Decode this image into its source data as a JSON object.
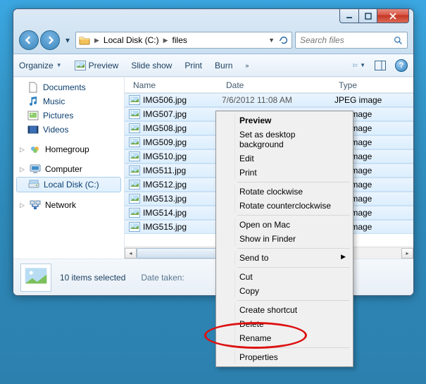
{
  "breadcrumb": {
    "segments": [
      "Local Disk (C:)",
      "files"
    ]
  },
  "search": {
    "placeholder": "Search files"
  },
  "toolbar": {
    "organize": "Organize",
    "preview": "Preview",
    "slideshow": "Slide show",
    "print": "Print",
    "burn": "Burn"
  },
  "sidebar": {
    "libs": [
      "Documents",
      "Music",
      "Pictures",
      "Videos"
    ],
    "home": "Homegroup",
    "roots": {
      "computer": "Computer",
      "c_drive": "Local Disk (C:)",
      "network": "Network"
    }
  },
  "columns": {
    "name": "Name",
    "date": "Date",
    "type": "Type"
  },
  "files": [
    {
      "name": "IMG506.jpg",
      "date": "7/6/2012 11:08 AM",
      "type": "JPEG image"
    },
    {
      "name": "IMG507.jpg",
      "date": "",
      "type": "EG image"
    },
    {
      "name": "IMG508.jpg",
      "date": "",
      "type": "EG image"
    },
    {
      "name": "IMG509.jpg",
      "date": "",
      "type": "EG image"
    },
    {
      "name": "IMG510.jpg",
      "date": "",
      "type": "EG image"
    },
    {
      "name": "IMG511.jpg",
      "date": "",
      "type": "EG image"
    },
    {
      "name": "IMG512.jpg",
      "date": "",
      "type": "EG image"
    },
    {
      "name": "IMG513.jpg",
      "date": "",
      "type": "EG image"
    },
    {
      "name": "IMG514.jpg",
      "date": "",
      "type": "EG image"
    },
    {
      "name": "IMG515.jpg",
      "date": "",
      "type": "EG image"
    }
  ],
  "details": {
    "sel_count": "10 items selected",
    "meta_label": "Date taken:"
  },
  "ctx": {
    "preview": "Preview",
    "set_bg": "Set as desktop background",
    "edit": "Edit",
    "print": "Print",
    "rot_cw": "Rotate clockwise",
    "rot_ccw": "Rotate counterclockwise",
    "open_mac": "Open on Mac",
    "show_finder": "Show in Finder",
    "send_to": "Send to",
    "cut": "Cut",
    "copy": "Copy",
    "shortcut": "Create shortcut",
    "delete": "Delete",
    "rename": "Rename",
    "props": "Properties"
  }
}
